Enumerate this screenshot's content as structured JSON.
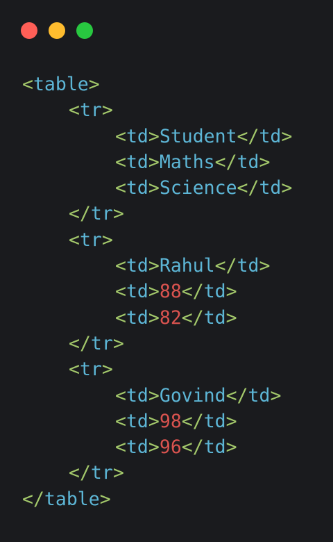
{
  "window": {
    "buttons": [
      {
        "name": "close",
        "color": "#ff5f57"
      },
      {
        "name": "minimize",
        "color": "#febc2e"
      },
      {
        "name": "maximize",
        "color": "#28c840"
      }
    ]
  },
  "colors": {
    "background": "#1a1b1e",
    "punctuation": "#a3c86b",
    "tag": "#5db6d6",
    "text": "#5db6d6",
    "number": "#d9534f"
  },
  "code": {
    "lines": [
      {
        "indent": 0,
        "tokens": [
          {
            "t": "punct",
            "v": "<"
          },
          {
            "t": "tag",
            "v": "table"
          },
          {
            "t": "punct",
            "v": ">"
          }
        ]
      },
      {
        "indent": 1,
        "tokens": [
          {
            "t": "punct",
            "v": "<"
          },
          {
            "t": "tag",
            "v": "tr"
          },
          {
            "t": "punct",
            "v": ">"
          }
        ]
      },
      {
        "indent": 2,
        "tokens": [
          {
            "t": "punct",
            "v": "<"
          },
          {
            "t": "tag",
            "v": "td"
          },
          {
            "t": "punct",
            "v": ">"
          },
          {
            "t": "txt",
            "v": "Student"
          },
          {
            "t": "punct",
            "v": "</"
          },
          {
            "t": "tag",
            "v": "td"
          },
          {
            "t": "punct",
            "v": ">"
          }
        ]
      },
      {
        "indent": 2,
        "tokens": [
          {
            "t": "punct",
            "v": "<"
          },
          {
            "t": "tag",
            "v": "td"
          },
          {
            "t": "punct",
            "v": ">"
          },
          {
            "t": "txt",
            "v": "Maths"
          },
          {
            "t": "punct",
            "v": "</"
          },
          {
            "t": "tag",
            "v": "td"
          },
          {
            "t": "punct",
            "v": ">"
          }
        ]
      },
      {
        "indent": 2,
        "tokens": [
          {
            "t": "punct",
            "v": "<"
          },
          {
            "t": "tag",
            "v": "td"
          },
          {
            "t": "punct",
            "v": ">"
          },
          {
            "t": "txt",
            "v": "Science"
          },
          {
            "t": "punct",
            "v": "</"
          },
          {
            "t": "tag",
            "v": "td"
          },
          {
            "t": "punct",
            "v": ">"
          }
        ]
      },
      {
        "indent": 1,
        "tokens": [
          {
            "t": "punct",
            "v": "</"
          },
          {
            "t": "tag",
            "v": "tr"
          },
          {
            "t": "punct",
            "v": ">"
          }
        ]
      },
      {
        "indent": 1,
        "tokens": [
          {
            "t": "punct",
            "v": "<"
          },
          {
            "t": "tag",
            "v": "tr"
          },
          {
            "t": "punct",
            "v": ">"
          }
        ]
      },
      {
        "indent": 2,
        "tokens": [
          {
            "t": "punct",
            "v": "<"
          },
          {
            "t": "tag",
            "v": "td"
          },
          {
            "t": "punct",
            "v": ">"
          },
          {
            "t": "txt",
            "v": "Rahul"
          },
          {
            "t": "punct",
            "v": "</"
          },
          {
            "t": "tag",
            "v": "td"
          },
          {
            "t": "punct",
            "v": ">"
          }
        ]
      },
      {
        "indent": 2,
        "tokens": [
          {
            "t": "punct",
            "v": "<"
          },
          {
            "t": "tag",
            "v": "td"
          },
          {
            "t": "punct",
            "v": ">"
          },
          {
            "t": "num",
            "v": "88"
          },
          {
            "t": "punct",
            "v": "</"
          },
          {
            "t": "tag",
            "v": "td"
          },
          {
            "t": "punct",
            "v": ">"
          }
        ]
      },
      {
        "indent": 2,
        "tokens": [
          {
            "t": "punct",
            "v": "<"
          },
          {
            "t": "tag",
            "v": "td"
          },
          {
            "t": "punct",
            "v": ">"
          },
          {
            "t": "num",
            "v": "82"
          },
          {
            "t": "punct",
            "v": "</"
          },
          {
            "t": "tag",
            "v": "td"
          },
          {
            "t": "punct",
            "v": ">"
          }
        ]
      },
      {
        "indent": 1,
        "tokens": [
          {
            "t": "punct",
            "v": "</"
          },
          {
            "t": "tag",
            "v": "tr"
          },
          {
            "t": "punct",
            "v": ">"
          }
        ]
      },
      {
        "indent": 1,
        "tokens": [
          {
            "t": "punct",
            "v": "<"
          },
          {
            "t": "tag",
            "v": "tr"
          },
          {
            "t": "punct",
            "v": ">"
          }
        ]
      },
      {
        "indent": 2,
        "tokens": [
          {
            "t": "punct",
            "v": "<"
          },
          {
            "t": "tag",
            "v": "td"
          },
          {
            "t": "punct",
            "v": ">"
          },
          {
            "t": "txt",
            "v": "Govind"
          },
          {
            "t": "punct",
            "v": "</"
          },
          {
            "t": "tag",
            "v": "td"
          },
          {
            "t": "punct",
            "v": ">"
          }
        ]
      },
      {
        "indent": 2,
        "tokens": [
          {
            "t": "punct",
            "v": "<"
          },
          {
            "t": "tag",
            "v": "td"
          },
          {
            "t": "punct",
            "v": ">"
          },
          {
            "t": "num",
            "v": "98"
          },
          {
            "t": "punct",
            "v": "</"
          },
          {
            "t": "tag",
            "v": "td"
          },
          {
            "t": "punct",
            "v": ">"
          }
        ]
      },
      {
        "indent": 2,
        "tokens": [
          {
            "t": "punct",
            "v": "<"
          },
          {
            "t": "tag",
            "v": "td"
          },
          {
            "t": "punct",
            "v": ">"
          },
          {
            "t": "num",
            "v": "96"
          },
          {
            "t": "punct",
            "v": "</"
          },
          {
            "t": "tag",
            "v": "td"
          },
          {
            "t": "punct",
            "v": ">"
          }
        ]
      },
      {
        "indent": 1,
        "tokens": [
          {
            "t": "punct",
            "v": "</"
          },
          {
            "t": "tag",
            "v": "tr"
          },
          {
            "t": "punct",
            "v": ">"
          }
        ]
      },
      {
        "indent": 0,
        "tokens": [
          {
            "t": "punct",
            "v": "</"
          },
          {
            "t": "tag",
            "v": "table"
          },
          {
            "t": "punct",
            "v": ">"
          }
        ]
      }
    ]
  }
}
